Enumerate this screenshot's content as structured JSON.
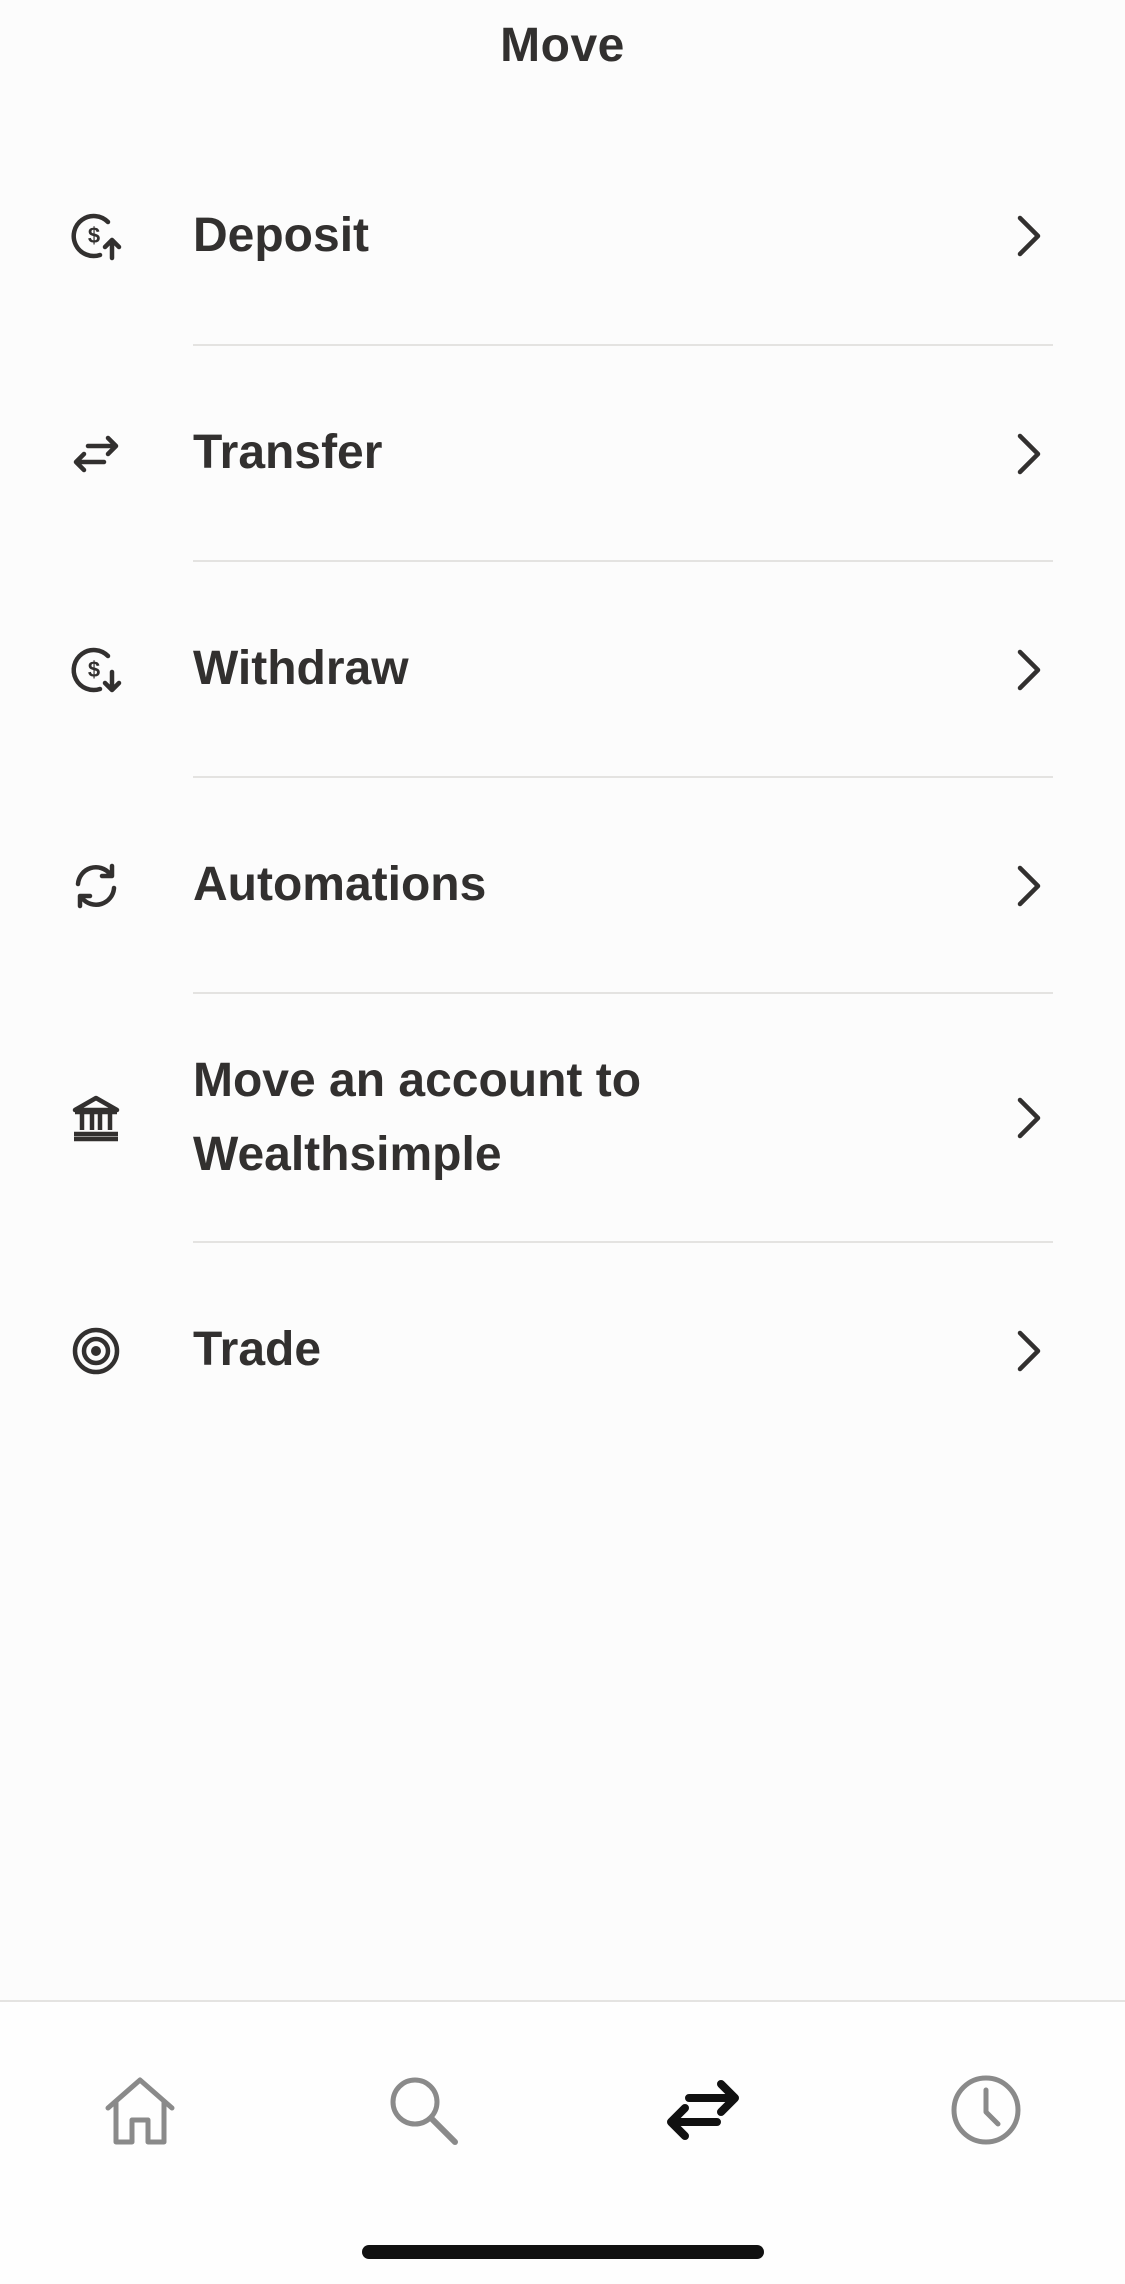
{
  "header": {
    "title": "Move"
  },
  "menu": {
    "items": [
      {
        "label": "Deposit",
        "icon": "dollar-deposit-icon"
      },
      {
        "label": "Transfer",
        "icon": "transfer-arrows-icon"
      },
      {
        "label": "Withdraw",
        "icon": "dollar-withdraw-icon"
      },
      {
        "label": "Automations",
        "icon": "refresh-cycle-icon"
      },
      {
        "label": "Move an account to Wealthsimple",
        "icon": "bank-icon"
      },
      {
        "label": "Trade",
        "icon": "target-icon"
      }
    ]
  },
  "tabbar": {
    "tabs": [
      {
        "name": "home",
        "icon": "home-icon",
        "active": false
      },
      {
        "name": "search",
        "icon": "search-icon",
        "active": false
      },
      {
        "name": "move",
        "icon": "transfer-arrows-icon",
        "active": true
      },
      {
        "name": "activity",
        "icon": "clock-icon",
        "active": false
      }
    ]
  },
  "colors": {
    "text": "#32302f",
    "divider": "#e4e3e1",
    "inactive_tab": "#8a8a8a",
    "background": "#fcfcfc"
  }
}
